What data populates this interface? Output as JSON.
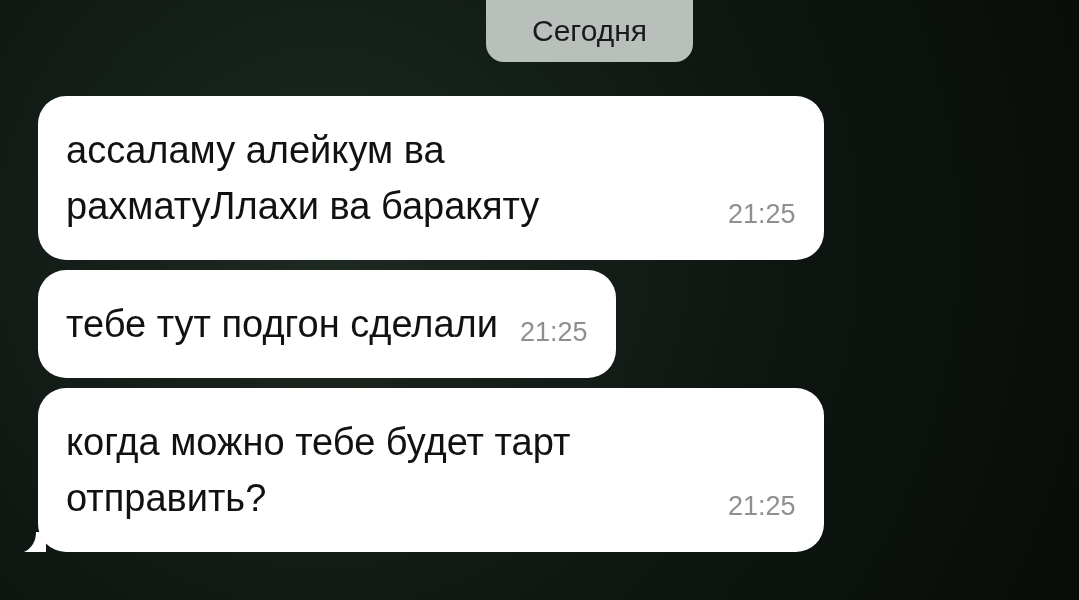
{
  "date_badge": "Сегодня",
  "messages": [
    {
      "text": "ассаламу алейкум ва рахматуЛлахи ва баракяту",
      "time": "21:25",
      "tail": false
    },
    {
      "text": "тебе тут подгон сделали",
      "time": "21:25",
      "tail": false
    },
    {
      "text": "когда можно тебе будет тарт отправить?",
      "time": "21:25",
      "tail": true
    }
  ]
}
